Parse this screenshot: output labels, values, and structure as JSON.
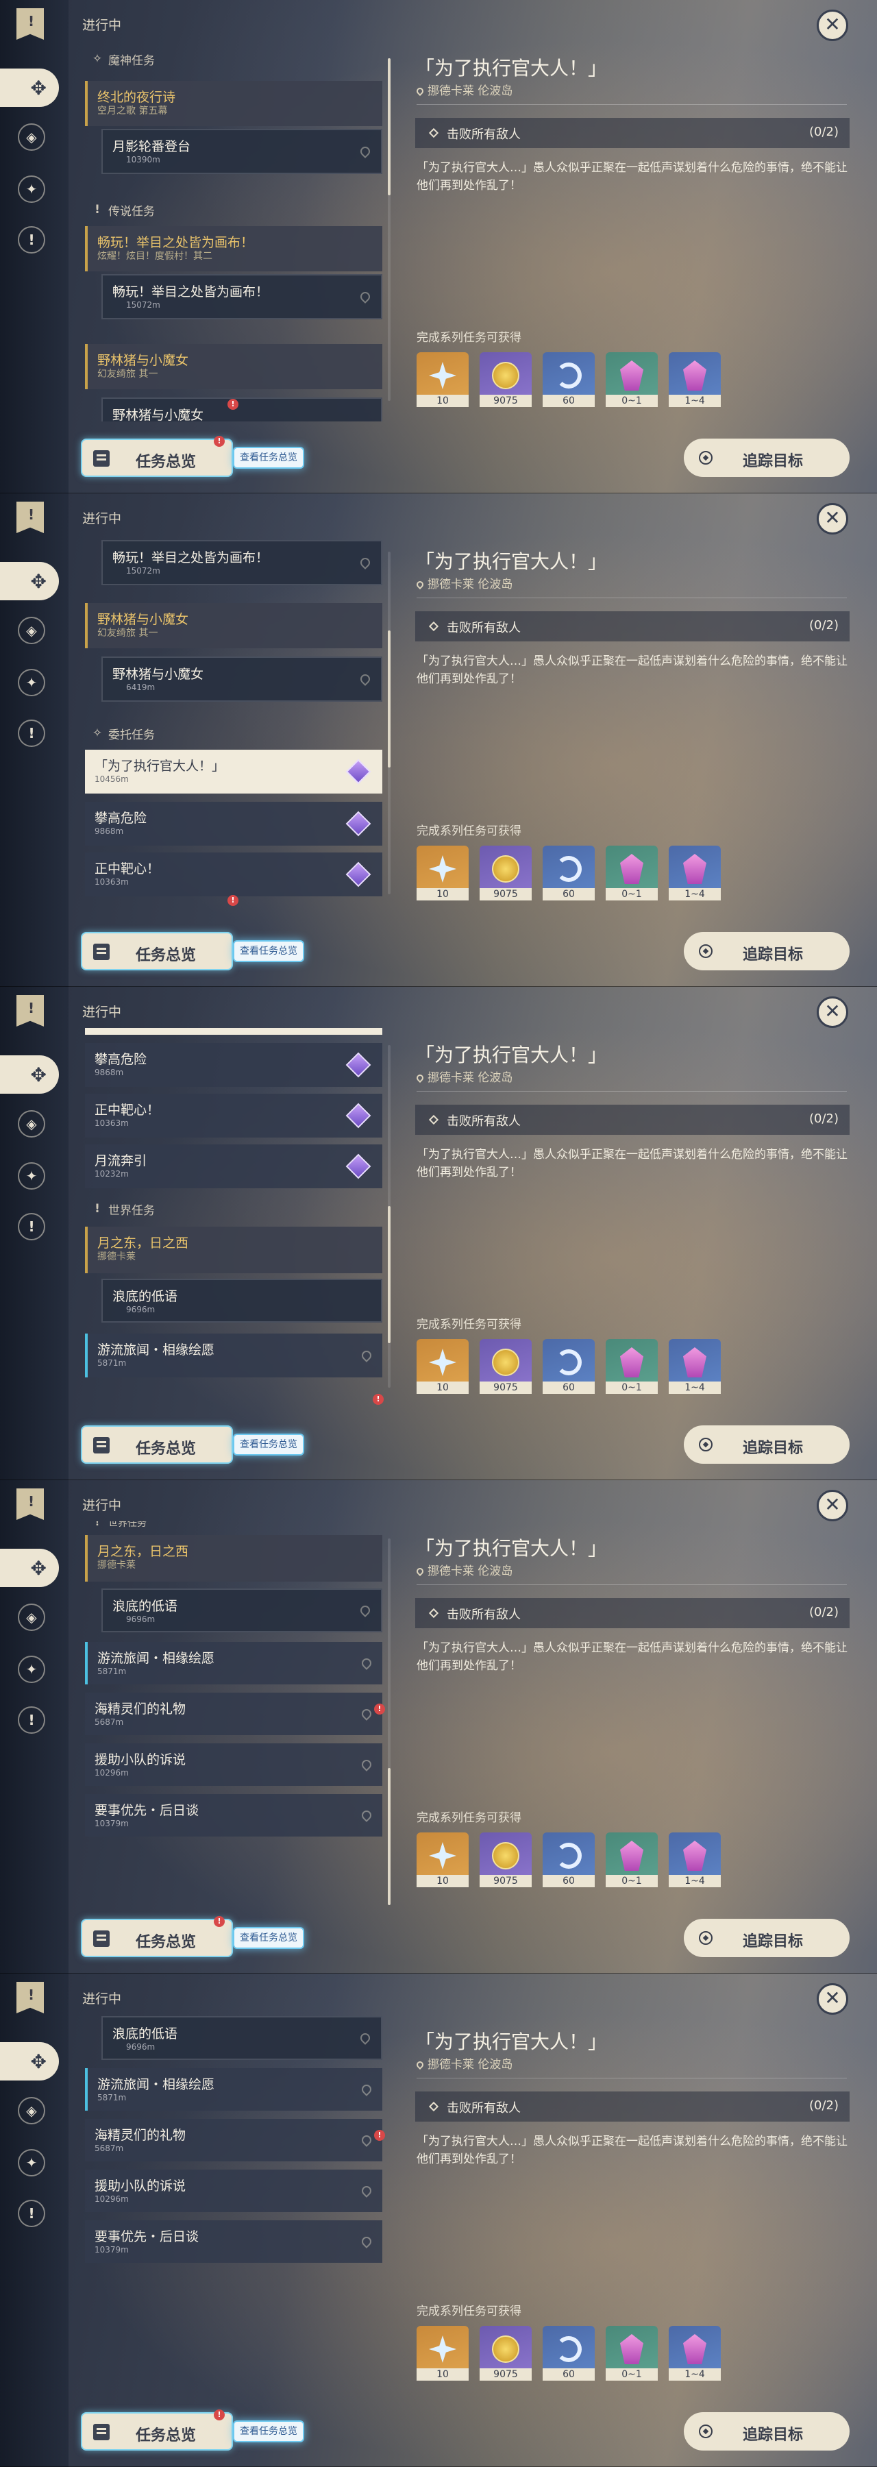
{
  "header": {
    "in_progress": "进行中",
    "rail_icons": [
      "quest-book-icon",
      "diamond-cluster-icon",
      "compass-diamond-icon",
      "star-diamond-icon",
      "exclamation-icon"
    ]
  },
  "quests": {
    "archon_category": "魔神任务",
    "archon_q1_title": "终北的夜行诗",
    "archon_q1_subtitle": "空月之歌 第五幕",
    "archon_q1_step": "月影轮番登台",
    "archon_q1_step_dist": "10390m",
    "legend_category": "传说任务",
    "legend_q1_title": "畅玩！举目之处皆为画布！",
    "legend_q1_subtitle": "炫耀！炫目！度假村！其二",
    "legend_q1_step": "畅玩！举目之处皆为画布！",
    "legend_q1_step_dist": "15072m",
    "legend_q2_title": "野林猪与小魔女",
    "legend_q2_subtitle": "幻友绮旅 其一",
    "legend_q2_step": "野林猪与小魔女",
    "legend_q2_step_dist": "6419m",
    "commission_category": "委托任务",
    "c1_title": "「为了执行官大人！」",
    "c1_dist": "10456m",
    "c2_title": "攀高危险",
    "c2_dist": "9868m",
    "c3_title": "正中靶心！",
    "c3_dist": "10363m",
    "c4_title": "月流奔引",
    "c4_dist": "10232m",
    "world_category": "世界任务",
    "w1_title": "月之东，日之西",
    "w1_subtitle": "挪德卡莱",
    "w1_step": "浪底的低语",
    "w1_step_dist": "9696m",
    "w2_title": "游流旅闻・相缘绘愿",
    "w2_dist": "5871m",
    "w3_title": "海精灵们的礼物",
    "w3_dist": "5687m",
    "w4_title": "援助小队的诉说",
    "w4_dist": "10296m",
    "w5_title": "要事优先・后日谈",
    "w5_dist": "10379m"
  },
  "detail": {
    "title": "「为了执行官大人！」",
    "location": "挪德卡莱 伦波岛",
    "objective": "击败所有敌人",
    "objective_count": "(0/2)",
    "description": "「为了执行官大人…」愚人众似乎正聚在一起低声谋划着什么危险的事情，绝不能让他们再到处作乱了！",
    "rewards_header": "完成系列任务可获得",
    "rewards": [
      {
        "icon": "primogem-icon",
        "amount": "10",
        "rarity": "5"
      },
      {
        "icon": "mora-icon",
        "amount": "9075",
        "rarity": "4"
      },
      {
        "icon": "adventure-exp-icon",
        "amount": "60",
        "rarity": "3"
      },
      {
        "icon": "crystal-ore-icon",
        "amount": "0~1",
        "rarity": "2"
      },
      {
        "icon": "crystal-cluster-icon",
        "amount": "1~4",
        "rarity": "3"
      }
    ]
  },
  "footer": {
    "overview_label": "任务总览",
    "overview_tip": "查看任务总览",
    "overview_badge": "!",
    "track_label": "追踪目标",
    "close_icon": "close-icon"
  },
  "colors": {
    "accent_gold": "#c8a24a",
    "accent_teal": "#4cc0e0",
    "commission_purple": "#8e6ad8",
    "badge_red": "#d84848"
  }
}
